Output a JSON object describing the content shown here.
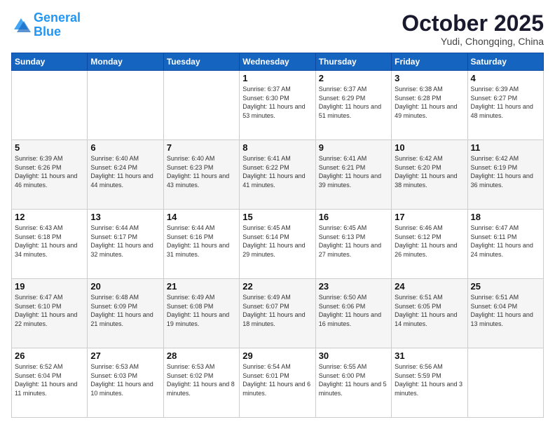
{
  "header": {
    "logo_line1": "General",
    "logo_line2": "Blue",
    "month": "October 2025",
    "location": "Yudi, Chongqing, China"
  },
  "days_of_week": [
    "Sunday",
    "Monday",
    "Tuesday",
    "Wednesday",
    "Thursday",
    "Friday",
    "Saturday"
  ],
  "weeks": [
    [
      {
        "num": "",
        "info": ""
      },
      {
        "num": "",
        "info": ""
      },
      {
        "num": "",
        "info": ""
      },
      {
        "num": "1",
        "info": "Sunrise: 6:37 AM\nSunset: 6:30 PM\nDaylight: 11 hours and 53 minutes."
      },
      {
        "num": "2",
        "info": "Sunrise: 6:37 AM\nSunset: 6:29 PM\nDaylight: 11 hours and 51 minutes."
      },
      {
        "num": "3",
        "info": "Sunrise: 6:38 AM\nSunset: 6:28 PM\nDaylight: 11 hours and 49 minutes."
      },
      {
        "num": "4",
        "info": "Sunrise: 6:39 AM\nSunset: 6:27 PM\nDaylight: 11 hours and 48 minutes."
      }
    ],
    [
      {
        "num": "5",
        "info": "Sunrise: 6:39 AM\nSunset: 6:26 PM\nDaylight: 11 hours and 46 minutes."
      },
      {
        "num": "6",
        "info": "Sunrise: 6:40 AM\nSunset: 6:24 PM\nDaylight: 11 hours and 44 minutes."
      },
      {
        "num": "7",
        "info": "Sunrise: 6:40 AM\nSunset: 6:23 PM\nDaylight: 11 hours and 43 minutes."
      },
      {
        "num": "8",
        "info": "Sunrise: 6:41 AM\nSunset: 6:22 PM\nDaylight: 11 hours and 41 minutes."
      },
      {
        "num": "9",
        "info": "Sunrise: 6:41 AM\nSunset: 6:21 PM\nDaylight: 11 hours and 39 minutes."
      },
      {
        "num": "10",
        "info": "Sunrise: 6:42 AM\nSunset: 6:20 PM\nDaylight: 11 hours and 38 minutes."
      },
      {
        "num": "11",
        "info": "Sunrise: 6:42 AM\nSunset: 6:19 PM\nDaylight: 11 hours and 36 minutes."
      }
    ],
    [
      {
        "num": "12",
        "info": "Sunrise: 6:43 AM\nSunset: 6:18 PM\nDaylight: 11 hours and 34 minutes."
      },
      {
        "num": "13",
        "info": "Sunrise: 6:44 AM\nSunset: 6:17 PM\nDaylight: 11 hours and 32 minutes."
      },
      {
        "num": "14",
        "info": "Sunrise: 6:44 AM\nSunset: 6:16 PM\nDaylight: 11 hours and 31 minutes."
      },
      {
        "num": "15",
        "info": "Sunrise: 6:45 AM\nSunset: 6:14 PM\nDaylight: 11 hours and 29 minutes."
      },
      {
        "num": "16",
        "info": "Sunrise: 6:45 AM\nSunset: 6:13 PM\nDaylight: 11 hours and 27 minutes."
      },
      {
        "num": "17",
        "info": "Sunrise: 6:46 AM\nSunset: 6:12 PM\nDaylight: 11 hours and 26 minutes."
      },
      {
        "num": "18",
        "info": "Sunrise: 6:47 AM\nSunset: 6:11 PM\nDaylight: 11 hours and 24 minutes."
      }
    ],
    [
      {
        "num": "19",
        "info": "Sunrise: 6:47 AM\nSunset: 6:10 PM\nDaylight: 11 hours and 22 minutes."
      },
      {
        "num": "20",
        "info": "Sunrise: 6:48 AM\nSunset: 6:09 PM\nDaylight: 11 hours and 21 minutes."
      },
      {
        "num": "21",
        "info": "Sunrise: 6:49 AM\nSunset: 6:08 PM\nDaylight: 11 hours and 19 minutes."
      },
      {
        "num": "22",
        "info": "Sunrise: 6:49 AM\nSunset: 6:07 PM\nDaylight: 11 hours and 18 minutes."
      },
      {
        "num": "23",
        "info": "Sunrise: 6:50 AM\nSunset: 6:06 PM\nDaylight: 11 hours and 16 minutes."
      },
      {
        "num": "24",
        "info": "Sunrise: 6:51 AM\nSunset: 6:05 PM\nDaylight: 11 hours and 14 minutes."
      },
      {
        "num": "25",
        "info": "Sunrise: 6:51 AM\nSunset: 6:04 PM\nDaylight: 11 hours and 13 minutes."
      }
    ],
    [
      {
        "num": "26",
        "info": "Sunrise: 6:52 AM\nSunset: 6:04 PM\nDaylight: 11 hours and 11 minutes."
      },
      {
        "num": "27",
        "info": "Sunrise: 6:53 AM\nSunset: 6:03 PM\nDaylight: 11 hours and 10 minutes."
      },
      {
        "num": "28",
        "info": "Sunrise: 6:53 AM\nSunset: 6:02 PM\nDaylight: 11 hours and 8 minutes."
      },
      {
        "num": "29",
        "info": "Sunrise: 6:54 AM\nSunset: 6:01 PM\nDaylight: 11 hours and 6 minutes."
      },
      {
        "num": "30",
        "info": "Sunrise: 6:55 AM\nSunset: 6:00 PM\nDaylight: 11 hours and 5 minutes."
      },
      {
        "num": "31",
        "info": "Sunrise: 6:56 AM\nSunset: 5:59 PM\nDaylight: 11 hours and 3 minutes."
      },
      {
        "num": "",
        "info": ""
      }
    ]
  ]
}
